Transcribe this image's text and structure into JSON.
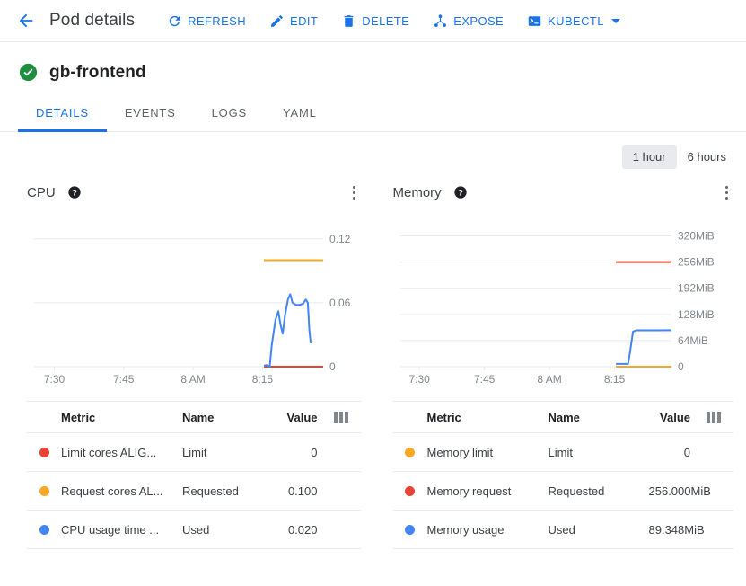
{
  "toolbar": {
    "back_label": "back-arrow",
    "title": "Pod details",
    "actions": [
      {
        "label": "REFRESH",
        "icon": "refresh-icon"
      },
      {
        "label": "EDIT",
        "icon": "pencil-icon"
      },
      {
        "label": "DELETE",
        "icon": "trash-icon"
      },
      {
        "label": "EXPOSE",
        "icon": "share-nodes-icon"
      },
      {
        "label": "KUBECTL",
        "icon": "terminal-icon",
        "has_caret": true
      }
    ]
  },
  "resource": {
    "name": "gb-frontend",
    "status_icon": "check-circle-icon",
    "status_color": "#1e8e3e"
  },
  "tabs": [
    {
      "label": "DETAILS",
      "active": true
    },
    {
      "label": "EVENTS",
      "active": false
    },
    {
      "label": "LOGS",
      "active": false
    },
    {
      "label": "YAML",
      "active": false
    }
  ],
  "time_range": {
    "options": [
      {
        "label": "1 hour",
        "selected": true
      },
      {
        "label": "6 hours",
        "selected": false
      }
    ]
  },
  "colors": {
    "blue": "#4285f4",
    "orange": "#f9a825",
    "red": "#ea4335",
    "accent": "#1a73e8",
    "grid": "#e8eaed",
    "axis_text": "#80868b"
  },
  "cpu_panel": {
    "title": "CPU",
    "help_icon": "help-circle-icon",
    "menu_icon": "kebab-menu-icon",
    "table": {
      "columns": [
        "Metric",
        "Name",
        "Value"
      ],
      "column_picker_icon": "column-selector-icon",
      "rows": [
        {
          "color": "#ea4335",
          "metric": "Limit cores ALIG...",
          "name": "Limit",
          "value": "0"
        },
        {
          "color": "#f9a825",
          "metric": "Request cores AL...",
          "name": "Requested",
          "value": "0.100"
        },
        {
          "color": "#4285f4",
          "metric": "CPU usage time ...",
          "name": "Used",
          "value": "0.020"
        }
      ]
    }
  },
  "memory_panel": {
    "title": "Memory",
    "help_icon": "help-circle-icon",
    "menu_icon": "kebab-menu-icon",
    "table": {
      "columns": [
        "Metric",
        "Name",
        "Value"
      ],
      "column_picker_icon": "column-selector-icon",
      "rows": [
        {
          "color": "#f9a825",
          "metric": "Memory limit",
          "name": "Limit",
          "value": "0"
        },
        {
          "color": "#ea4335",
          "metric": "Memory request",
          "name": "Requested",
          "value": "256.000MiB"
        },
        {
          "color": "#4285f4",
          "metric": "Memory usage",
          "name": "Used",
          "value": "89.348MiB"
        }
      ]
    }
  },
  "chart_data": [
    {
      "id": "cpu",
      "type": "line",
      "title": "CPU",
      "xlabel": "",
      "ylabel": "",
      "x_ticks": [
        "7:30",
        "7:45",
        "8 AM",
        "8:15"
      ],
      "x_tick_positions": [
        0.07,
        0.31,
        0.55,
        0.79
      ],
      "y_ticks": [
        "0.12",
        "0.06",
        "0"
      ],
      "y_tick_values": [
        0.12,
        0.06,
        0
      ],
      "ylim": [
        0,
        0.135
      ],
      "grid": true,
      "legend": "none",
      "series": [
        {
          "name": "Limit cores ALIGN_RATE",
          "color": "#ea4335",
          "points": [
            [
              0.795,
              0
            ],
            [
              1.0,
              0
            ]
          ]
        },
        {
          "name": "Request cores ALIGN_RATE",
          "color": "#f9a825",
          "points": [
            [
              0.795,
              0.1
            ],
            [
              1.0,
              0.1
            ]
          ]
        },
        {
          "name": "CPU usage time",
          "color": "#4285f4",
          "points": [
            [
              0.795,
              0.001
            ],
            [
              0.805,
              0.0015
            ],
            [
              0.815,
              0.0
            ],
            [
              0.822,
              0.02
            ],
            [
              0.835,
              0.044
            ],
            [
              0.845,
              0.052
            ],
            [
              0.852,
              0.04
            ],
            [
              0.86,
              0.031
            ],
            [
              0.868,
              0.048
            ],
            [
              0.878,
              0.063
            ],
            [
              0.886,
              0.068
            ],
            [
              0.894,
              0.06
            ],
            [
              0.906,
              0.058
            ],
            [
              0.918,
              0.058
            ],
            [
              0.93,
              0.059
            ],
            [
              0.94,
              0.063
            ],
            [
              0.947,
              0.06
            ],
            [
              0.952,
              0.035
            ],
            [
              0.957,
              0.022
            ]
          ]
        }
      ]
    },
    {
      "id": "memory",
      "type": "line",
      "title": "Memory",
      "xlabel": "",
      "ylabel": "",
      "x_ticks": [
        "7:30",
        "7:45",
        "8 AM",
        "8:15"
      ],
      "x_tick_positions": [
        0.07,
        0.31,
        0.55,
        0.79
      ],
      "y_ticks": [
        "320MiB",
        "256MiB",
        "192MiB",
        "128MiB",
        "64MiB",
        "0"
      ],
      "y_tick_values": [
        320,
        256,
        192,
        128,
        64,
        0
      ],
      "ylim": [
        0,
        352
      ],
      "grid": true,
      "legend": "none",
      "series": [
        {
          "name": "Memory limit",
          "color": "#f9a825",
          "points": [
            [
              0.795,
              0
            ],
            [
              1.0,
              0
            ]
          ]
        },
        {
          "name": "Memory request",
          "color": "#ea4335",
          "points": [
            [
              0.795,
              256
            ],
            [
              1.0,
              256
            ]
          ]
        },
        {
          "name": "Memory usage",
          "color": "#4285f4",
          "points": [
            [
              0.795,
              7
            ],
            [
              0.84,
              7
            ],
            [
              0.848,
              40
            ],
            [
              0.858,
              86
            ],
            [
              0.87,
              89
            ],
            [
              0.9,
              89
            ],
            [
              0.95,
              89
            ],
            [
              1.0,
              89.348
            ]
          ]
        }
      ]
    }
  ]
}
